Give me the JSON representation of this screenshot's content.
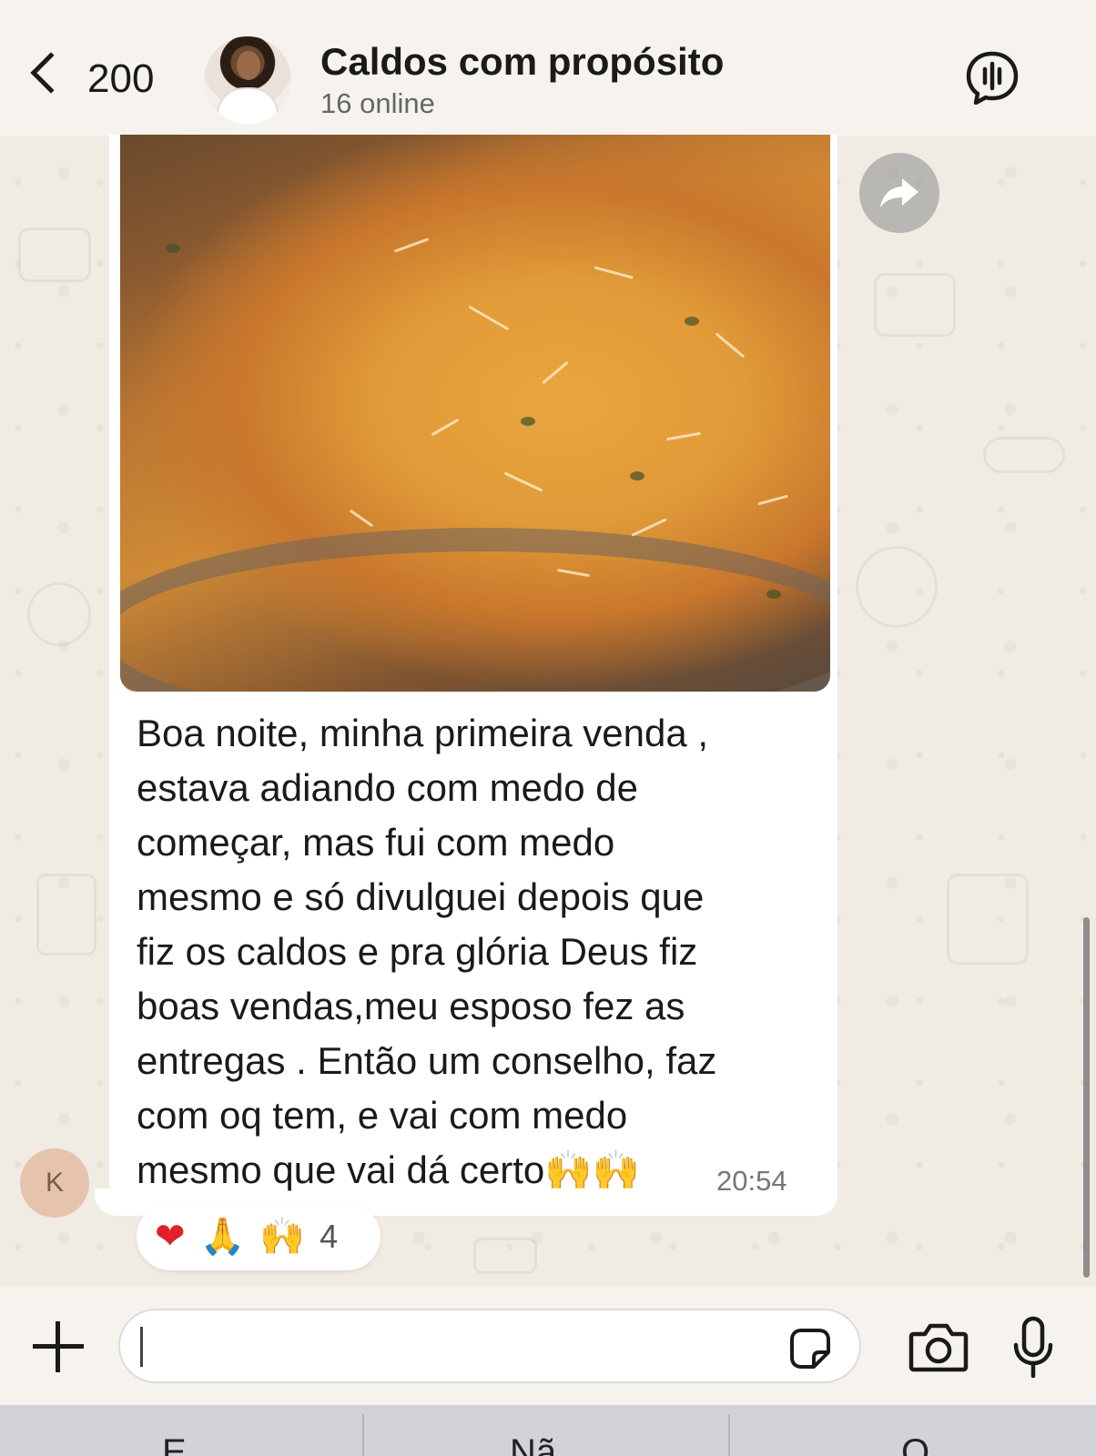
{
  "header": {
    "back_count": "200",
    "title": "Caldos com propósito",
    "subtitle": "16 online",
    "icons": {
      "back": "chevron-left-icon",
      "voice_chat": "voice-chat-icon"
    }
  },
  "message": {
    "media": "photo",
    "text": "Boa noite, minha primeira venda ,\nestava adiando com medo de\ncomeçar, mas fui com medo\nmesmo e só divulguei depois que\nfiz os caldos e pra glória Deus fiz\nboas vendas,meu esposo fez as\nentregas . Então  um conselho, faz\ncom oq tem, e vai com medo\nmesmo que vai dá certo🙌🙌",
    "time": "20:54",
    "sender_initial": "K"
  },
  "reactions": {
    "emojis": [
      "❤",
      "🙏",
      "🙌"
    ],
    "count": "4"
  },
  "composer": {
    "input_value": "",
    "icons": [
      "plus-icon",
      "sticker-icon",
      "camera-icon",
      "microphone-icon"
    ]
  },
  "bottom_bar": {
    "items": [
      "E",
      "Nã",
      "O"
    ]
  },
  "colors": {
    "background": "#efeae2",
    "bubble": "#ffffff",
    "header": "#f6f3ee",
    "bottom_bar": "#d1d3d9"
  }
}
